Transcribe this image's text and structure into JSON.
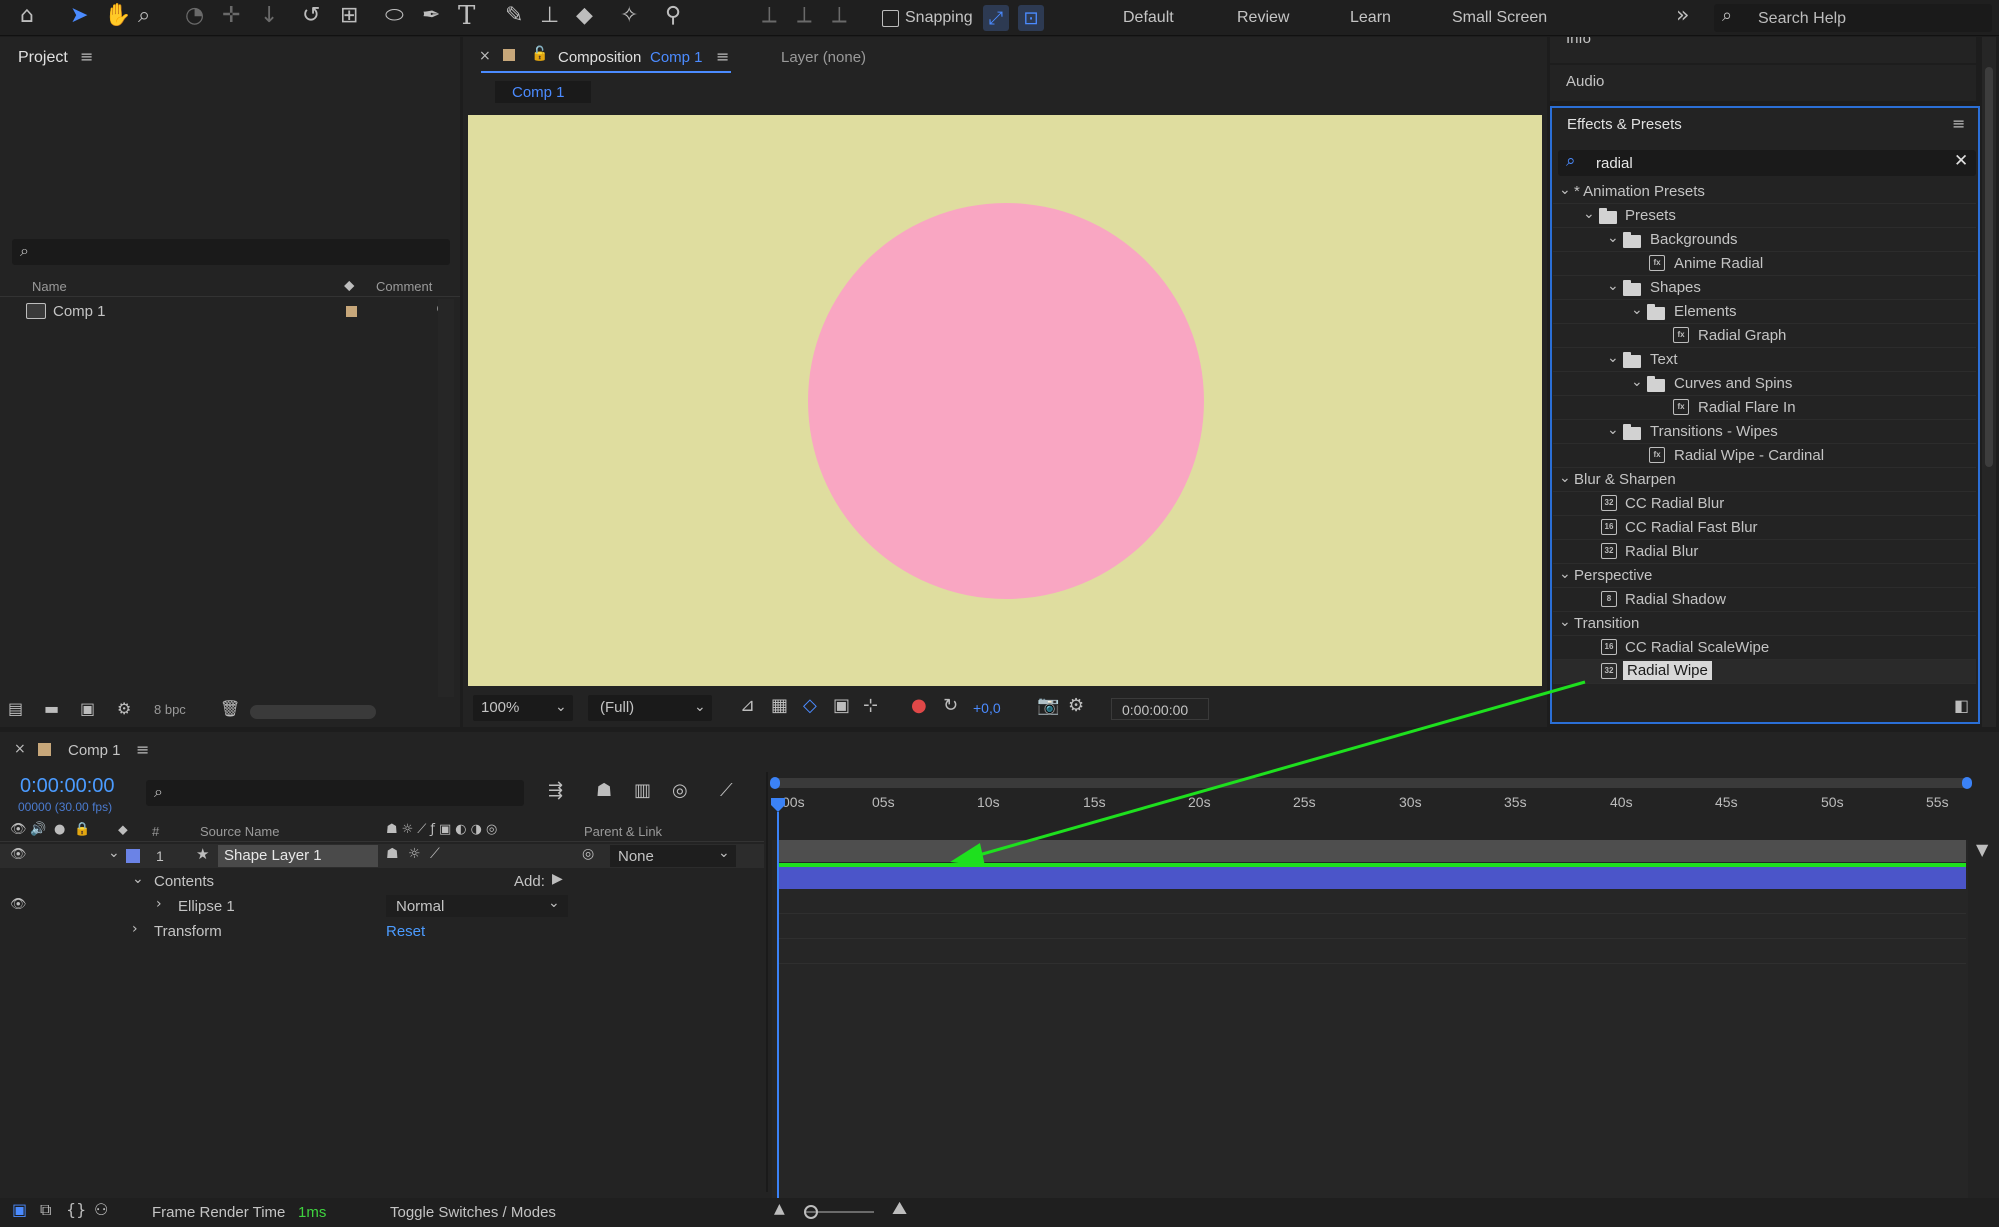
{
  "toolbar": {
    "snapping_label": "Snapping",
    "workspaces": [
      "Default",
      "Review",
      "Learn",
      "Small Screen"
    ],
    "search_placeholder": "Search Help"
  },
  "project": {
    "title": "Project",
    "col_name": "Name",
    "col_comment": "Comment",
    "items": [
      {
        "name": "Comp 1"
      }
    ],
    "bpc": "8 bpc"
  },
  "composition": {
    "tab_label": "Composition",
    "tab_comp": "Comp 1",
    "layer_tab": "Layer (none)",
    "subtab": "Comp 1",
    "bg_color": "#dfdd9f",
    "circle_color": "#f9a6c2",
    "zoom": "100%",
    "resolution": "(Full)",
    "exposure": "+0,0",
    "timecode": "0:00:00:00"
  },
  "right_panels": {
    "info": "Info",
    "audio": "Audio",
    "effects_title": "Effects & Presets",
    "search_value": "radial",
    "tree": [
      {
        "label": "* Animation Presets",
        "type": "group"
      },
      {
        "label": "Presets",
        "type": "folder"
      },
      {
        "label": "Backgrounds",
        "type": "folder"
      },
      {
        "label": "Anime Radial",
        "type": "preset"
      },
      {
        "label": "Shapes",
        "type": "folder"
      },
      {
        "label": "Elements",
        "type": "folder"
      },
      {
        "label": "Radial Graph",
        "type": "preset"
      },
      {
        "label": "Text",
        "type": "folder"
      },
      {
        "label": "Curves and Spins",
        "type": "folder"
      },
      {
        "label": "Radial Flare In",
        "type": "preset"
      },
      {
        "label": "Transitions - Wipes",
        "type": "folder"
      },
      {
        "label": "Radial Wipe - Cardinal",
        "type": "preset"
      },
      {
        "label": "Blur & Sharpen",
        "type": "group"
      },
      {
        "label": "CC Radial Blur",
        "type": "effect"
      },
      {
        "label": "CC Radial Fast Blur",
        "type": "effect"
      },
      {
        "label": "Radial Blur",
        "type": "effect"
      },
      {
        "label": "Perspective",
        "type": "group"
      },
      {
        "label": "Radial Shadow",
        "type": "effect"
      },
      {
        "label": "Transition",
        "type": "group"
      },
      {
        "label": "CC Radial ScaleWipe",
        "type": "effect"
      },
      {
        "label": "Radial Wipe",
        "type": "effect"
      }
    ]
  },
  "timeline": {
    "comp_tab": "Comp 1",
    "timecode": "0:00:00:00",
    "fps_label": "00000 (30.00 fps)",
    "col_hash": "#",
    "col_source": "Source Name",
    "col_parent": "Parent & Link",
    "layer_num": "1",
    "layer_name": "Shape Layer 1",
    "parent_value": "None",
    "contents": "Contents",
    "add_label": "Add:",
    "ellipse": "Ellipse 1",
    "blend_mode": "Normal",
    "transform": "Transform",
    "reset": "Reset",
    "ruler": [
      "00s",
      "05s",
      "10s",
      "15s",
      "20s",
      "25s",
      "30s",
      "35s",
      "40s",
      "45s",
      "50s",
      "55s"
    ],
    "render_label": "Frame Render Time",
    "render_value": "1ms",
    "toggle_label": "Toggle Switches / Modes",
    "layer_bar_color": "#4b55c9",
    "arrow_color": "#1ee01e"
  }
}
